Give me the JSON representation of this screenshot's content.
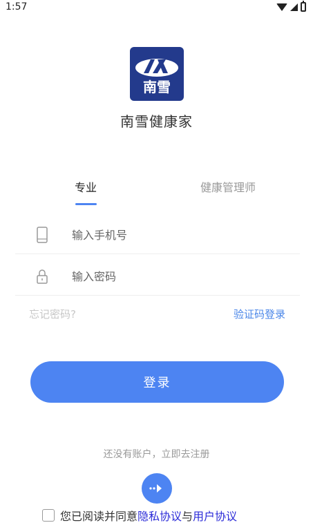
{
  "status_bar": {
    "time": "1:57"
  },
  "app": {
    "name": "南雪健康家",
    "logo_text": "南雪"
  },
  "tabs": [
    {
      "label": "专业",
      "active": true
    },
    {
      "label": "健康管理师",
      "active": false
    }
  ],
  "form": {
    "phone_placeholder": "输入手机号",
    "password_placeholder": "输入密码",
    "forgot_label": "忘记密码?",
    "sms_login_label": "验证码登录",
    "login_label": "登录"
  },
  "register": {
    "hint": "还没有账户，立即去注册"
  },
  "agreement": {
    "prefix": "您已阅读并同意",
    "privacy": "隐私协议",
    "joiner": "与",
    "user": "用户协议"
  },
  "colors": {
    "accent": "#4d84f2",
    "link": "#2b2bd8",
    "logo_bg": "#233a8c"
  }
}
